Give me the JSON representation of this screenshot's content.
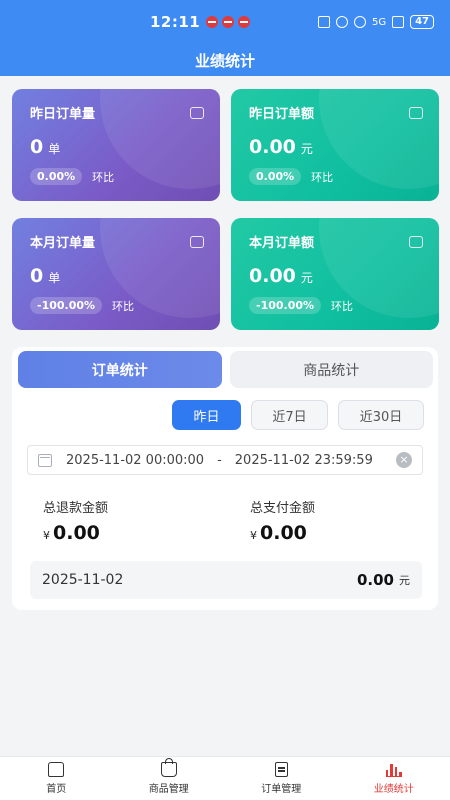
{
  "status_bar": {
    "time": "12:11",
    "right_labels": "5G",
    "battery": "47"
  },
  "nav": {
    "title": "业绩统计"
  },
  "cards": [
    {
      "title": "昨日订单量",
      "value": "0",
      "unit": "单",
      "ratio": "0.00%",
      "ratio_label": "环比",
      "icon": "calendar-icon",
      "color": "#7a5bc7"
    },
    {
      "title": "昨日订单额",
      "value": "0.00",
      "unit": "元",
      "ratio": "0.00%",
      "ratio_label": "环比",
      "icon": "wallet-icon",
      "color": "#10bfa0"
    },
    {
      "title": "本月订单量",
      "value": "0",
      "unit": "单",
      "ratio": "-100.00%",
      "ratio_label": "环比",
      "icon": "calendar-icon",
      "color": "#7a5bc7"
    },
    {
      "title": "本月订单额",
      "value": "0.00",
      "unit": "元",
      "ratio": "-100.00%",
      "ratio_label": "环比",
      "icon": "wallet-icon",
      "color": "#10bfa0"
    }
  ],
  "tabs": [
    {
      "label": "订单统计",
      "active": true
    },
    {
      "label": "商品统计",
      "active": false
    }
  ],
  "ranges": [
    {
      "label": "昨日",
      "selected": true
    },
    {
      "label": "近7日",
      "selected": false
    },
    {
      "label": "近30日",
      "selected": false
    }
  ],
  "date_range": {
    "start": "2025-11-02 00:00:00",
    "separator": "-",
    "end": "2025-11-02 23:59:59"
  },
  "stats": {
    "refund": {
      "label": "总退款金额",
      "currency": "¥",
      "value": "0.00"
    },
    "paid": {
      "label": "总支付金额",
      "currency": "¥",
      "value": "0.00"
    }
  },
  "records": [
    {
      "date": "2025-11-02",
      "amount": "0.00",
      "unit": "元"
    }
  ],
  "tabbar": [
    {
      "label": "首页",
      "icon": "home-icon",
      "active": false
    },
    {
      "label": "商品管理",
      "icon": "bag-icon",
      "active": false
    },
    {
      "label": "订单管理",
      "icon": "clipboard-icon",
      "active": false
    },
    {
      "label": "业绩统计",
      "icon": "bar-chart-icon",
      "active": true
    }
  ],
  "colors": {
    "primary": "#3d8bf3",
    "active_tab": "#e53935",
    "range_selected": "#2f7af0"
  }
}
